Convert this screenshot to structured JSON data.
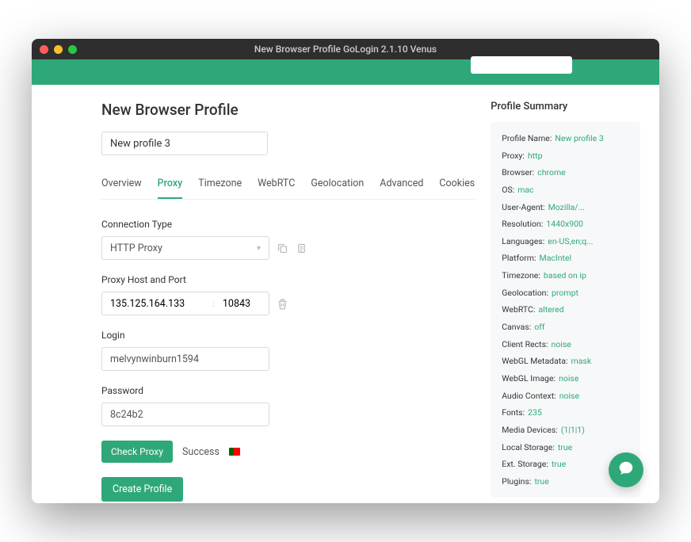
{
  "window": {
    "title": "New Browser Profile GoLogin 2.1.10 Venus"
  },
  "page": {
    "title": "New Browser Profile",
    "profile_name": "New profile 3"
  },
  "tabs": {
    "overview": "Overview",
    "proxy": "Proxy",
    "timezone": "Timezone",
    "webrtc": "WebRTC",
    "geolocation": "Geolocation",
    "advanced": "Advanced",
    "cookies": "Cookies"
  },
  "proxy": {
    "connection_type_label": "Connection Type",
    "connection_type_value": "HTTP Proxy",
    "host_port_label": "Proxy Host and Port",
    "host": "135.125.164.133",
    "port": "10843",
    "login_label": "Login",
    "login": "melvynwinburn1594",
    "password_label": "Password",
    "password": "8c24b2",
    "check_button": "Check Proxy",
    "success": "Success"
  },
  "create_button": "Create Profile",
  "sidebar": {
    "title": "Profile Summary",
    "rows": [
      {
        "k": "Profile Name:",
        "v": "New profile 3"
      },
      {
        "k": "Proxy:",
        "v": "http"
      },
      {
        "k": "Browser:",
        "v": "chrome"
      },
      {
        "k": "OS:",
        "v": "mac"
      },
      {
        "k": "User-Agent:",
        "v": "Mozilla/..."
      },
      {
        "k": "Resolution:",
        "v": "1440x900"
      },
      {
        "k": "Languages:",
        "v": "en-US,en;q..."
      },
      {
        "k": "Platform:",
        "v": "MacIntel"
      },
      {
        "k": "Timezone:",
        "v": "based on ip"
      },
      {
        "k": "Geolocation:",
        "v": "prompt"
      },
      {
        "k": "WebRTC:",
        "v": "altered"
      },
      {
        "k": "Canvas:",
        "v": "off"
      },
      {
        "k": "Client Rects:",
        "v": "noise"
      },
      {
        "k": "WebGL Metadata:",
        "v": "mask"
      },
      {
        "k": "WebGL Image:",
        "v": "noise"
      },
      {
        "k": "Audio Context:",
        "v": "noise"
      },
      {
        "k": "Fonts:",
        "v": "235"
      },
      {
        "k": "Media Devices:",
        "v": "(1|1|1)"
      },
      {
        "k": "Local Storage:",
        "v": "true"
      },
      {
        "k": "Ext. Storage:",
        "v": "true"
      },
      {
        "k": "Plugins:",
        "v": "true"
      }
    ]
  }
}
